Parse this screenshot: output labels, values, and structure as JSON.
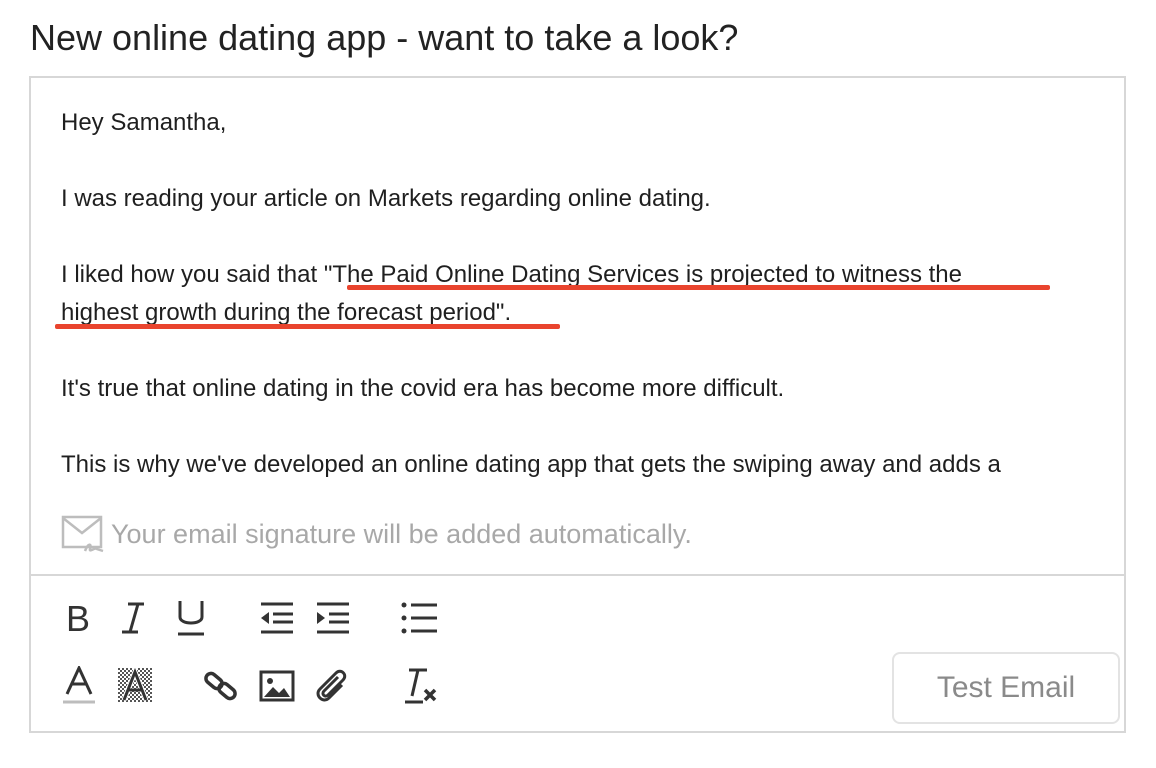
{
  "subject": "New online dating app - want to take a look?",
  "email_body": {
    "greeting": "Hey Samantha,",
    "p1": "I was reading your article on Markets regarding online dating.",
    "p2_prefix": "I liked how you said that ",
    "p2_quote_line1": "\"The Paid Online Dating Services is projected to witness the",
    "p2_quote_line2": "highest growth during the forecast period\".",
    "p3": "It's true that online dating in the covid era has become more difficult.",
    "p4": "This is why we've developed an online dating app that  gets the swiping away and adds a"
  },
  "signature_hint": "Your email signature will be added automatically.",
  "toolbar": {
    "test_email_label": "Test Email",
    "buttons": [
      "bold-icon",
      "italic-icon",
      "underline-icon",
      "outdent-icon",
      "indent-icon",
      "bullet-list-icon",
      "text-color-icon",
      "highlight-icon",
      "link-icon",
      "image-icon",
      "attachment-icon",
      "clear-format-icon"
    ]
  },
  "colors": {
    "highlight_underline": "#e9442e",
    "icon": "#333333",
    "border": "#d7d7d7",
    "placeholder": "#a8a8a8"
  }
}
